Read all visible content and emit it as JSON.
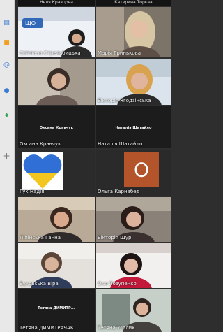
{
  "top_names": {
    "left": "Неля Кравцова",
    "right": "Катерина Торкаа"
  },
  "participants": [
    {
      "id": "p1",
      "name": "Світлана Стрельбицька"
    },
    {
      "id": "p2",
      "name": "Марія Гринькова"
    },
    {
      "id": "p3",
      "name": "Оксана Кравчук",
      "caption": "Оксана Кравчук"
    },
    {
      "id": "p4",
      "name": "Наталія Шатайло",
      "caption": "Наталія Шатайло"
    },
    {
      "id": "p5",
      "name": "Вікторія Ягодзінська"
    },
    {
      "id": "p6",
      "name": "Гук Надія"
    },
    {
      "id": "p7",
      "name": "Ольга Карнабед",
      "avatar_letter": "О"
    },
    {
      "id": "p8",
      "name": "Ліпінська Ганна"
    },
    {
      "id": "p9",
      "name": "Вікторія Щур"
    },
    {
      "id": "p10",
      "name": "Буковська Віра"
    },
    {
      "id": "p11",
      "name": "Оля Йозупенко"
    },
    {
      "id": "p12",
      "name": "Тетяна ДИМИТРАЧАК",
      "caption": "Тетяна ДИМИТР..."
    },
    {
      "id": "p13",
      "name": "Тетяна Уголик"
    }
  ],
  "rail_icons": [
    "chat-icon",
    "folder-icon",
    "at-sign-icon",
    "person-icon",
    "location-pin-icon",
    "plus-icon"
  ],
  "colors": {
    "flag_blue": "#2f6fd6",
    "flag_yellow": "#f3c61f",
    "avatar_bg": "#b4542a"
  }
}
